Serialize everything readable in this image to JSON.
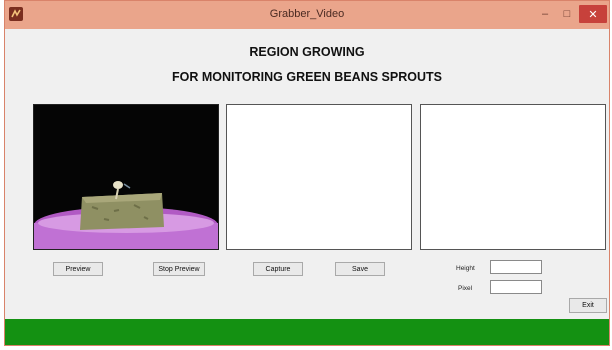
{
  "window": {
    "title": "Grabber_Video",
    "controls": {
      "minimize": "–",
      "maximize": "□",
      "close": "✕"
    },
    "titlebar_color": "#eaa58b",
    "close_color": "#c7413b"
  },
  "header": {
    "line1": "REGION GROWING",
    "line2": "FOR MONITORING GREEN BEANS SPROUTS"
  },
  "buttons": {
    "preview": "Preview",
    "stop_preview": "Stop Preview",
    "capture": "Capture",
    "save": "Save",
    "exit": "Exit"
  },
  "fields": {
    "height_label": "Height",
    "height_value": "",
    "pixel_label": "Pixel",
    "pixel_value": ""
  },
  "icons": {
    "app": "matlab-figure-icon"
  },
  "colors": {
    "footer_bar": "#149112",
    "tray": "#c86fd8",
    "sponge": "#8a8a5a"
  }
}
